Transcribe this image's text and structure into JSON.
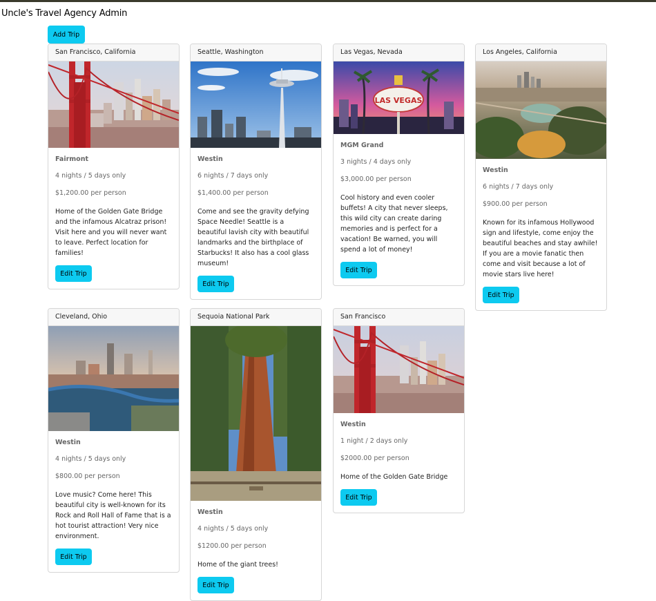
{
  "app": {
    "title": "Uncle's Travel Agency Admin"
  },
  "toolbar": {
    "add_trip_label": "Add Trip"
  },
  "trips": [
    {
      "location": "San Francisco, California",
      "hotel": "Fairmont",
      "duration": "4 nights / 5 days only",
      "price": "$1,200.00 per person",
      "description": "Home of the Golden Gate Bridge and the infamous Alcatraz prison! Visit here and you will never want to leave. Perfect location for families!",
      "edit_label": "Edit Trip"
    },
    {
      "location": "Seattle, Washington",
      "hotel": "Westin",
      "duration": "6 nights / 7 days only",
      "price": "$1,400.00 per person",
      "description": "Come and see the gravity defying Space Needle! Seattle is a beautiful lavish city with beautiful landmarks and the birthplace of Starbucks! It also has a cool glass museum!",
      "edit_label": "Edit Trip"
    },
    {
      "location": "Las Vegas, Nevada",
      "hotel": "MGM Grand",
      "duration": "3 nights / 4 days only",
      "price": "$3,000.00 per person",
      "description": "Cool history and even cooler buffets! A city that never sleeps, this wild city can create daring memories and is perfect for a vacation! Be warned, you will spend a lot of money!",
      "edit_label": "Edit Trip",
      "sign_text": "LAS VEGAS"
    },
    {
      "location": "Los Angeles, California",
      "hotel": "Westin",
      "duration": "6 nights / 7 days only",
      "price": "$900.00 per person",
      "description": "Known for its infamous Hollywood sign and lifestyle, come enjoy the beautiful beaches and stay awhile! If you are a movie fanatic then come and visit because a lot of movie stars live here!",
      "edit_label": "Edit Trip"
    },
    {
      "location": "Cleveland, Ohio",
      "hotel": "Westin",
      "duration": "4 nights / 5 days only",
      "price": "$800.00 per person",
      "description": "Love music? Come here! This beautiful city is well-known for its Rock and Roll Hall of Fame that is a hot tourist attraction! Very nice environment.",
      "edit_label": "Edit Trip"
    },
    {
      "location": "Sequoia National Park",
      "hotel": "Westin",
      "duration": "4 nights / 5 days only",
      "price": "$1200.00 per person",
      "description": "Home of the giant trees!",
      "edit_label": "Edit Trip"
    },
    {
      "location": "San Francisco",
      "hotel": "Westin",
      "duration": "1 night / 2 days only",
      "price": "$2000.00 per person",
      "description": "Home of the Golden Gate Bridge",
      "edit_label": "Edit Trip"
    }
  ],
  "colors": {
    "button": "#0dcaf0",
    "header_bg": "#f7f7f7"
  }
}
